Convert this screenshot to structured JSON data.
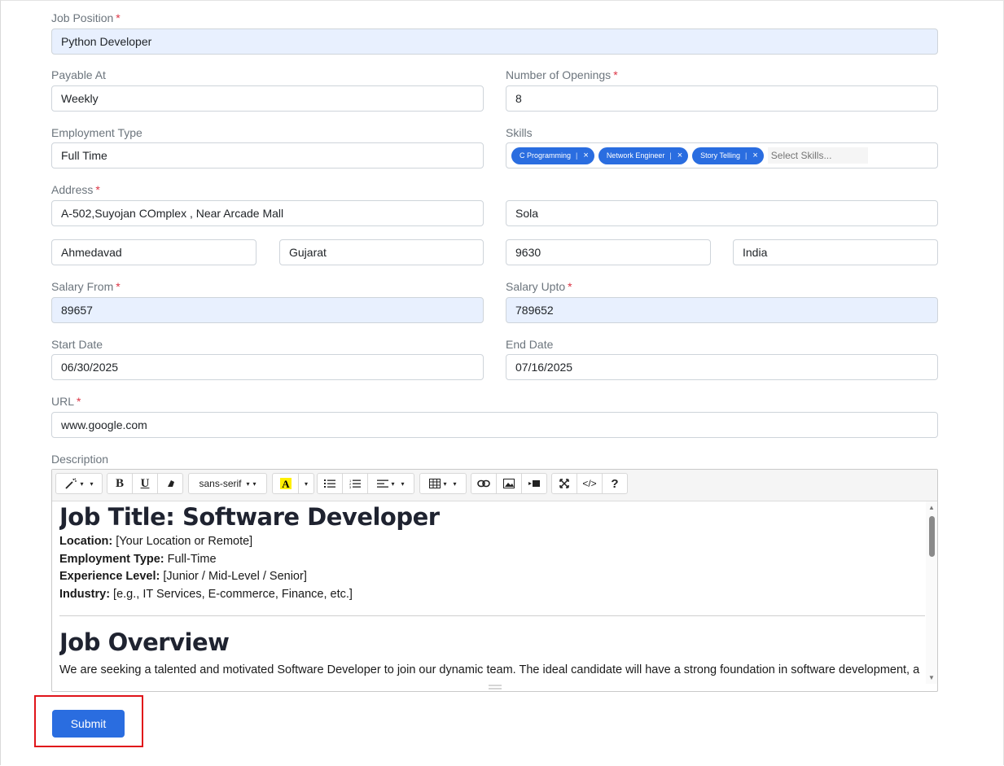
{
  "form": {
    "job_position": {
      "label": "Job Position",
      "value": "Python Developer"
    },
    "payable_at": {
      "label": "Payable At",
      "value": "Weekly"
    },
    "openings": {
      "label": "Number of Openings",
      "value": "8"
    },
    "employment_type": {
      "label": "Employment Type",
      "value": "Full Time"
    },
    "skills": {
      "label": "Skills",
      "chips": [
        "C Programming",
        "Network Engineer",
        "Story Telling"
      ],
      "remove_glyph": "×",
      "placeholder": "Select Skills..."
    },
    "address": {
      "label": "Address",
      "line1": "A-502,Suyojan COmplex , Near Arcade Mall",
      "line2": "Sola",
      "city": "Ahmedavad",
      "state": "Gujarat",
      "zip": "9630",
      "country": "India"
    },
    "salary_from": {
      "label": "Salary From",
      "value": "89657"
    },
    "salary_upto": {
      "label": "Salary Upto",
      "value": "789652"
    },
    "start_date": {
      "label": "Start Date",
      "value": "06/30/2025"
    },
    "end_date": {
      "label": "End Date",
      "value": "07/16/2025"
    },
    "url": {
      "label": "URL",
      "value": "www.google.com"
    },
    "description": {
      "label": "Description",
      "toolbar": {
        "font_name": "sans-serif",
        "bold": "B",
        "underline": "U",
        "help": "?",
        "code": "</>",
        "icons": [
          "magic-icon",
          "eraser-icon",
          "text-color-icon",
          "unordered-list-icon",
          "ordered-list-icon",
          "paragraph-align-icon",
          "table-icon",
          "link-icon",
          "picture-icon",
          "video-icon",
          "fullscreen-icon"
        ]
      },
      "content": {
        "heading1": "Job Title: Software Developer",
        "location_label": "Location:",
        "location_value": " [Your Location or Remote]",
        "employment_label": "Employment Type:",
        "employment_value": " Full-Time",
        "experience_label": "Experience Level:",
        "experience_value": " [Junior / Mid-Level / Senior]",
        "industry_label": "Industry:",
        "industry_value": " [e.g., IT Services, E-commerce, Finance, etc.]",
        "heading2": "Job Overview",
        "overview": "We are seeking a talented and motivated Software Developer to join our dynamic team. The ideal candidate will have a strong foundation in software development, a"
      }
    },
    "required_mark": "*",
    "submit_label": "Submit"
  },
  "colors": {
    "accent": "#2a6de0",
    "required": "#dc3545",
    "highlight": "#e0141a",
    "autofill": "#e8f0fe"
  }
}
